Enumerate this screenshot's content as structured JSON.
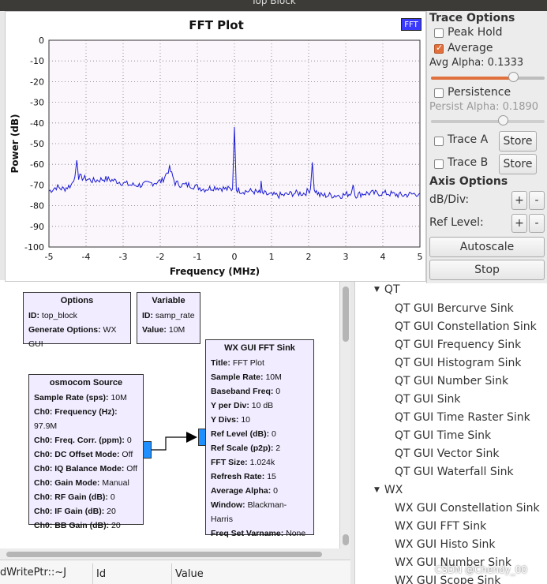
{
  "window": {
    "title": "Top Block"
  },
  "plot": {
    "title": "FFT Plot",
    "legend_badge": "FFT",
    "trace_color": "#1a1ad6",
    "bg_color": "#fbf6fb",
    "chart_data": {
      "type": "line",
      "title": "FFT Plot",
      "xlabel": "Frequency (MHz)",
      "ylabel": "Power (dB)",
      "xlim": [
        -5,
        5
      ],
      "ylim": [
        -100,
        0
      ],
      "x_ticks": [
        "-5",
        "-4",
        "-3",
        "-2",
        "-1",
        "0",
        "1",
        "2",
        "3",
        "4",
        "5"
      ],
      "y_ticks": [
        "0",
        "-10",
        "-20",
        "-30",
        "-40",
        "-50",
        "-60",
        "-70",
        "-80",
        "-90",
        "-100"
      ],
      "grid": true,
      "series": [
        {
          "x": [
            -5.0,
            -4.8,
            -4.6,
            -4.4,
            -4.3,
            -4.25,
            -4.2,
            -4.0,
            -3.8,
            -3.5,
            -3.2,
            -3.0,
            -2.8,
            -2.5,
            -2.2,
            -1.95,
            -1.75,
            -1.6,
            -1.4,
            -1.2,
            -1.0,
            -0.8,
            -0.5,
            -0.2,
            -0.05,
            0.0,
            0.05,
            0.2,
            0.5,
            0.7,
            0.72,
            0.75,
            1.0,
            1.3,
            1.6,
            1.9,
            2.05,
            2.1,
            2.15,
            2.3,
            2.6,
            2.9,
            3.15,
            3.2,
            3.25,
            3.5,
            3.8,
            4.1,
            4.5,
            5.0
          ],
          "y": [
            -73,
            -71,
            -72,
            -70,
            -66,
            -58,
            -66,
            -67,
            -68,
            -67,
            -68,
            -69,
            -70,
            -70,
            -69,
            -68,
            -62,
            -69,
            -70,
            -70,
            -71,
            -72,
            -71,
            -72,
            -72,
            -42,
            -72,
            -73,
            -73,
            -74,
            -68,
            -74,
            -75,
            -75,
            -74,
            -74,
            -72,
            -59,
            -72,
            -75,
            -75,
            -75,
            -74,
            -70,
            -75,
            -74,
            -74,
            -74,
            -75,
            -74
          ]
        }
      ]
    }
  },
  "controls": {
    "trace_options": "Trace Options",
    "peak_hold": "Peak Hold",
    "peak_hold_checked": false,
    "average": "Average",
    "average_checked": true,
    "avg_alpha": "Avg Alpha: 0.1333",
    "avg_alpha_level": 0.72,
    "persistence": "Persistence",
    "persistence_checked": false,
    "persist_alpha": "Persist Alpha: 0.1890",
    "persist_alpha_level": 0.63,
    "trace_a": "Trace A",
    "trace_b": "Trace B",
    "store": "Store",
    "axis_options": "Axis Options",
    "db_div": "dB/Div:",
    "ref_level": "Ref Level:",
    "plus": "+",
    "minus": "-",
    "autoscale": "Autoscale",
    "stop": "Stop"
  },
  "blocks": {
    "options": {
      "title": "Options",
      "rows": [
        [
          "ID:",
          "top_block"
        ],
        [
          "Generate Options:",
          "WX GUI"
        ]
      ]
    },
    "variable": {
      "title": "Variable",
      "rows": [
        [
          "ID:",
          "samp_rate"
        ],
        [
          "Value:",
          "10M"
        ]
      ]
    },
    "osmocom": {
      "title": "osmocom Source",
      "rows": [
        [
          "Sample Rate (sps):",
          "10M"
        ],
        [
          "Ch0: Frequency (Hz):",
          "97.9M"
        ],
        [
          "Ch0: Freq. Corr. (ppm):",
          "0"
        ],
        [
          "Ch0: DC Offset Mode:",
          "Off"
        ],
        [
          "Ch0: IQ Balance Mode:",
          "Off"
        ],
        [
          "Ch0: Gain Mode:",
          "Manual"
        ],
        [
          "Ch0: RF Gain (dB):",
          "0"
        ],
        [
          "Ch0: IF Gain (dB):",
          "20"
        ],
        [
          "Ch0: BB Gain (dB):",
          "20"
        ]
      ]
    },
    "fftsink": {
      "title": "WX GUI FFT Sink",
      "rows": [
        [
          "Title:",
          "FFT Plot"
        ],
        [
          "Sample Rate:",
          "10M"
        ],
        [
          "Baseband Freq:",
          "0"
        ],
        [
          "Y per Div:",
          "10 dB"
        ],
        [
          "Y Divs:",
          "10"
        ],
        [
          "Ref Level (dB):",
          "0"
        ],
        [
          "Ref Scale (p2p):",
          "2"
        ],
        [
          "FFT Size:",
          "1.024k"
        ],
        [
          "Refresh Rate:",
          "15"
        ],
        [
          "Average Alpha:",
          "0"
        ],
        [
          "Window:",
          "Blackman-Harris"
        ],
        [
          "Freq Set Varname:",
          "None"
        ]
      ]
    }
  },
  "tree": {
    "qt_label": "QT",
    "qt_items": [
      "QT GUI Bercurve Sink",
      "QT GUI Constellation Sink",
      "QT GUI Frequency Sink",
      "QT GUI Histogram Sink",
      "QT GUI Number Sink",
      "QT GUI Sink",
      "QT GUI Time Raster Sink",
      "QT GUI Time Sink",
      "QT GUI Vector Sink",
      "QT GUI Waterfall Sink"
    ],
    "wx_label": "WX",
    "wx_items": [
      "WX GUI Constellation Sink",
      "WX GUI FFT Sink",
      "WX GUI Histo Sink",
      "WX GUI Number Sink",
      "WX GUI Scope Sink"
    ]
  },
  "bottom": {
    "col0": "dWritePtr::~J",
    "col_id": "Id",
    "col_value": "Value"
  },
  "watermark": "CSDN @Chendy_00"
}
